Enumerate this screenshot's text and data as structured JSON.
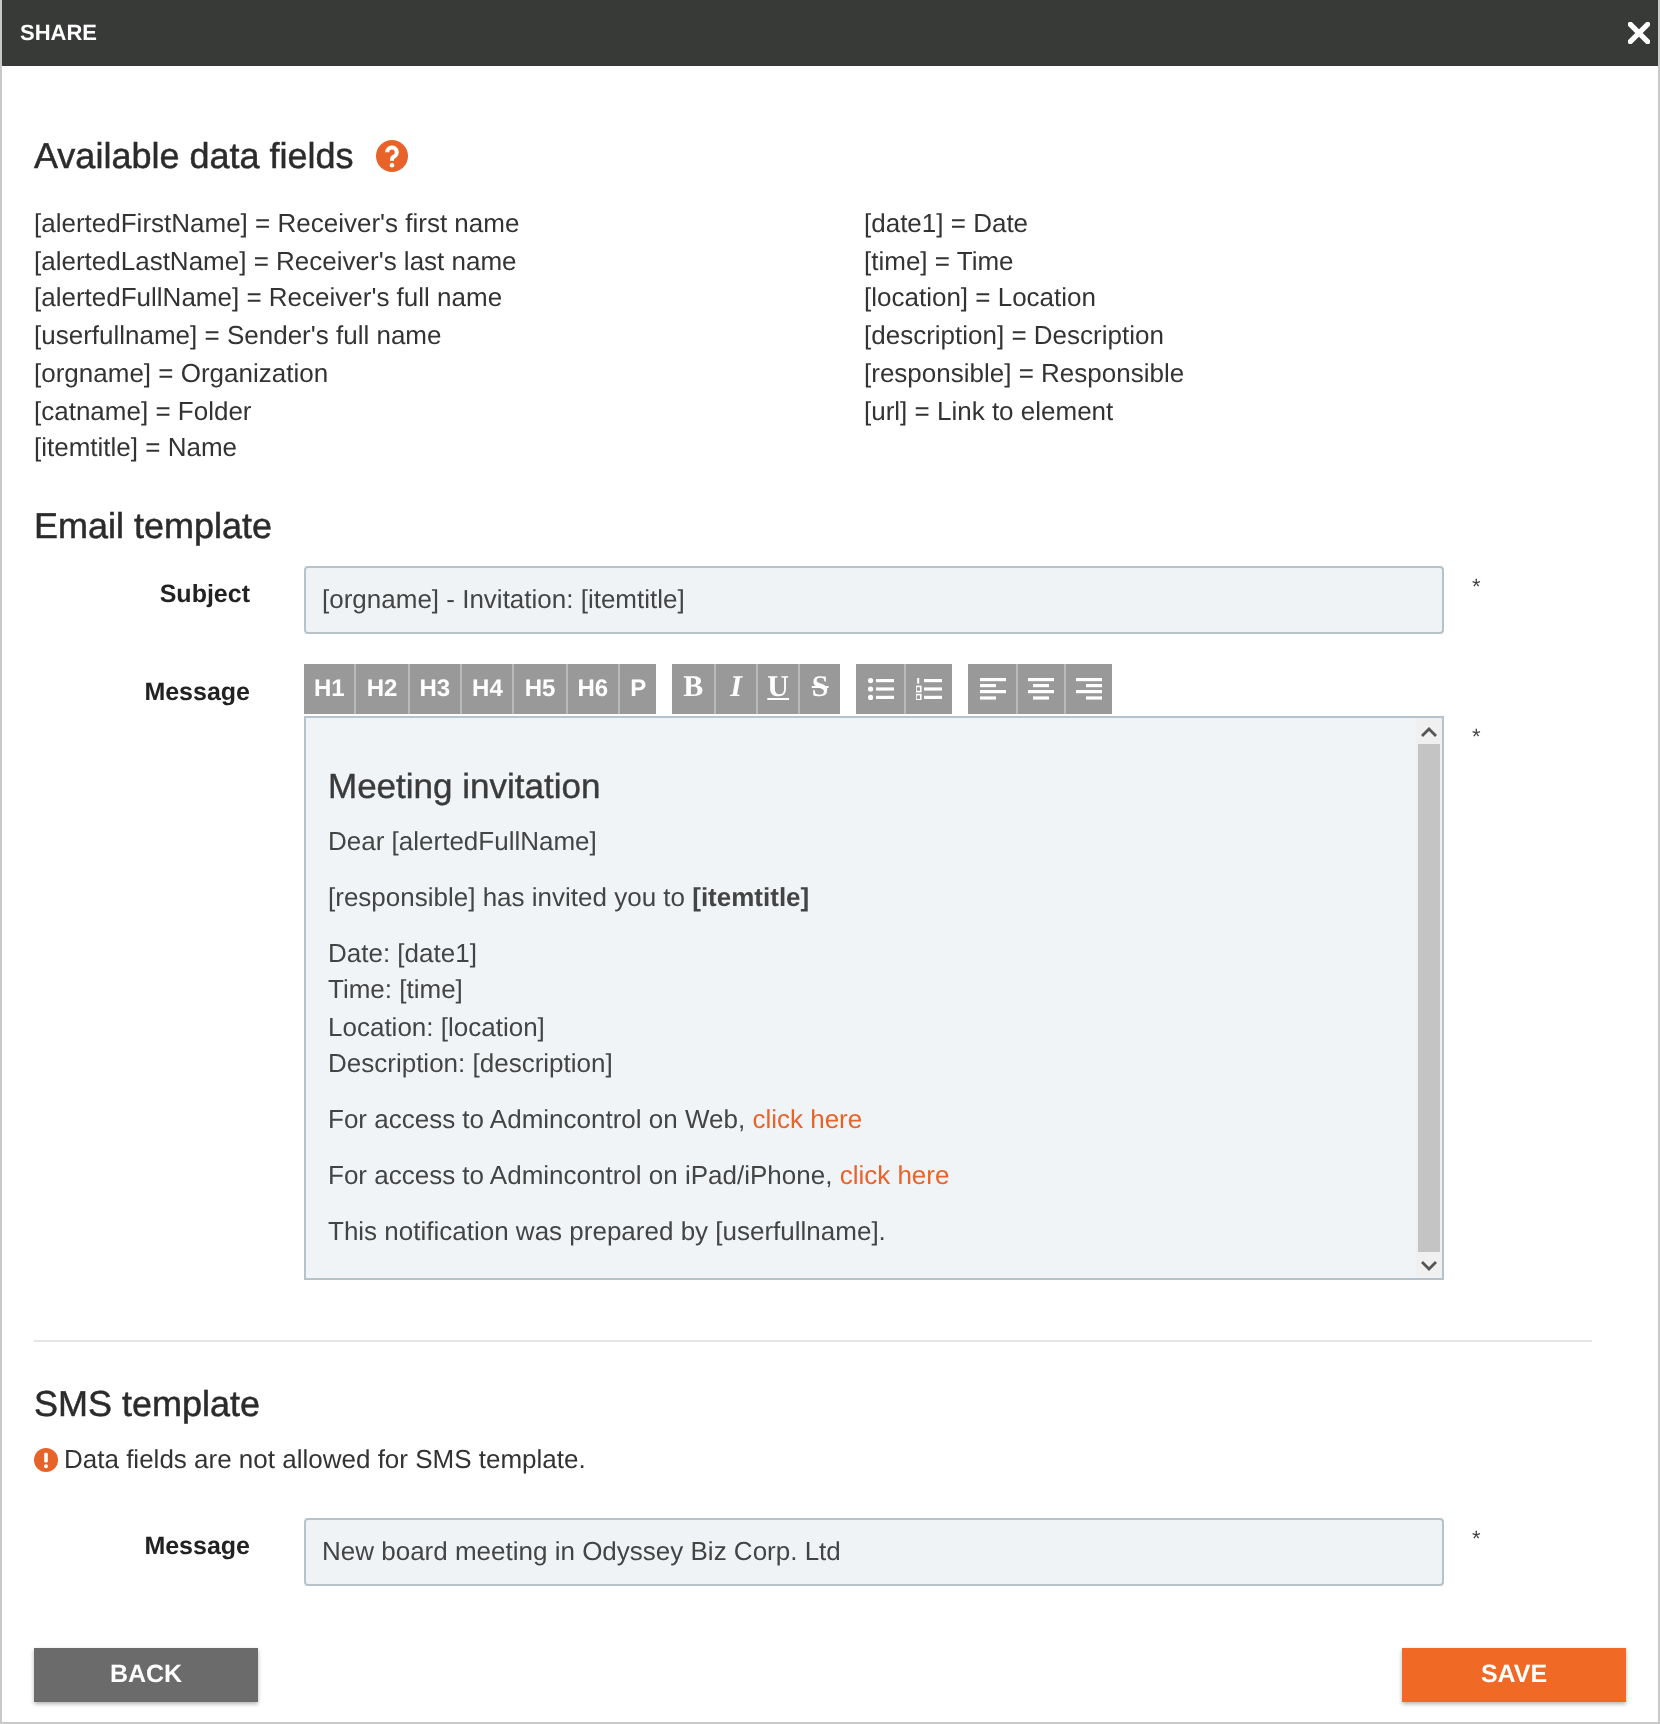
{
  "window": {
    "title": "SHARE"
  },
  "data_fields": {
    "title": "Available data fields",
    "columns": [
      [
        "[alertedFirstName] = Receiver's first name",
        "[alertedLastName] = Receiver's last name",
        "[alertedFullName] = Receiver's full name",
        "[userfullname] = Sender's full name",
        "[orgname] = Organization",
        "[catname] = Folder",
        "[itemtitle] = Name"
      ],
      [
        "[date1] = Date",
        "[time] = Time",
        "[location] = Location",
        "[description] = Description",
        "[responsible] = Responsible",
        "[url] = Link to element"
      ]
    ]
  },
  "email_template": {
    "title": "Email template",
    "subject": {
      "label": "Subject",
      "value": "[orgname] - Invitation: [itemtitle]",
      "required_mark": "*"
    },
    "message": {
      "label": "Message",
      "required_mark": "*",
      "toolbar": [
        [
          {
            "kind": "text",
            "label": "H1"
          },
          {
            "kind": "text",
            "label": "H2"
          },
          {
            "kind": "text",
            "label": "H3"
          },
          {
            "kind": "text",
            "label": "H4"
          },
          {
            "kind": "text",
            "label": "H5"
          },
          {
            "kind": "text",
            "label": "H6"
          },
          {
            "kind": "text",
            "label": "P"
          }
        ],
        [
          {
            "kind": "bold",
            "label": "B"
          },
          {
            "kind": "italic",
            "label": "I"
          },
          {
            "kind": "underline",
            "label": "U"
          },
          {
            "kind": "strike",
            "label": "S"
          }
        ],
        [
          {
            "kind": "bullet-list"
          },
          {
            "kind": "numbered-list"
          }
        ],
        [
          {
            "kind": "align-left"
          },
          {
            "kind": "align-center"
          },
          {
            "kind": "align-right"
          }
        ]
      ],
      "content": [
        {
          "kind": "heading",
          "text": "Meeting invitation"
        },
        {
          "kind": "paragraph",
          "text": "Dear [alertedFullName]"
        },
        {
          "kind": "paragraph",
          "text": "[responsible] has invited you to **[itemtitle]**"
        },
        {
          "kind": "lines",
          "lines": [
            "Date: [date1]",
            "Time: [time]",
            "Location: [location]",
            "Description: [description]"
          ]
        },
        {
          "kind": "paragraph",
          "text": "For access to Admincontrol on Web, ",
          "link": "click here"
        },
        {
          "kind": "paragraph",
          "text": "For access to Admincontrol on iPad/iPhone, ",
          "link": "click here"
        },
        {
          "kind": "paragraph",
          "text": "This notification was prepared by [userfullname]."
        }
      ]
    }
  },
  "sms_template": {
    "title": "SMS template",
    "notice": "Data fields are not allowed for SMS template.",
    "message": {
      "label": "Message",
      "value": "New board meeting in Odyssey Biz Corp. Ltd",
      "required_mark": "*"
    }
  },
  "buttons": [
    {
      "kind": "back",
      "label": "BACK"
    },
    {
      "kind": "save",
      "label": "SAVE"
    }
  ]
}
